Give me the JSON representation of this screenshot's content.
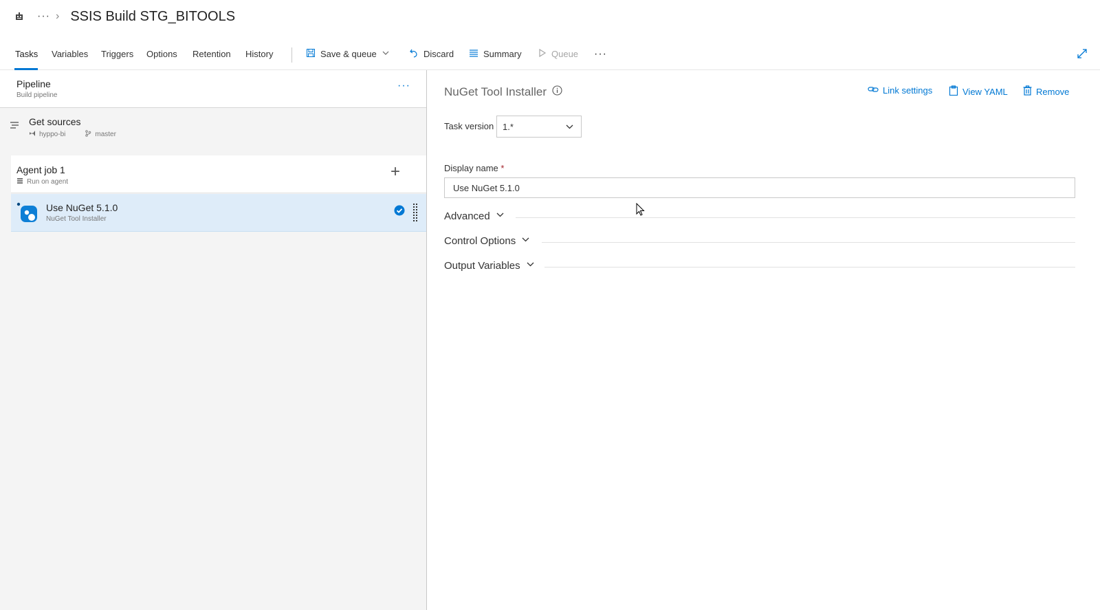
{
  "header": {
    "breadcrumb_dots": "···",
    "title": "SSIS Build STG_BITOOLS"
  },
  "tabs": [
    {
      "label": "Tasks",
      "active": true
    },
    {
      "label": "Variables"
    },
    {
      "label": "Triggers"
    },
    {
      "label": "Options"
    },
    {
      "label": "Retention"
    },
    {
      "label": "History"
    }
  ],
  "toolbar": {
    "save_queue": "Save & queue",
    "discard": "Discard",
    "summary": "Summary",
    "queue": "Queue",
    "more": "···"
  },
  "pipeline": {
    "title": "Pipeline",
    "subtitle": "Build pipeline",
    "more": "···"
  },
  "get_sources": {
    "title": "Get sources",
    "repo": "hyppo-bi",
    "branch": "master"
  },
  "agent_job": {
    "title": "Agent job 1",
    "subtitle": "Run on agent",
    "add": "+"
  },
  "task": {
    "title": "Use NuGet 5.1.0",
    "subtitle": "NuGet Tool Installer"
  },
  "details": {
    "title": "NuGet Tool Installer",
    "link_settings": "Link settings",
    "view_yaml": "View YAML",
    "remove": "Remove",
    "task_version_label": "Task version",
    "task_version_value": "1.*",
    "display_name_label": "Display name",
    "required_mark": "*",
    "display_name_value": "Use NuGet 5.1.0",
    "sections": [
      "Advanced",
      "Control Options",
      "Output Variables"
    ]
  },
  "colors": {
    "accent": "#0078d4",
    "selected_row": "#deecf9"
  }
}
